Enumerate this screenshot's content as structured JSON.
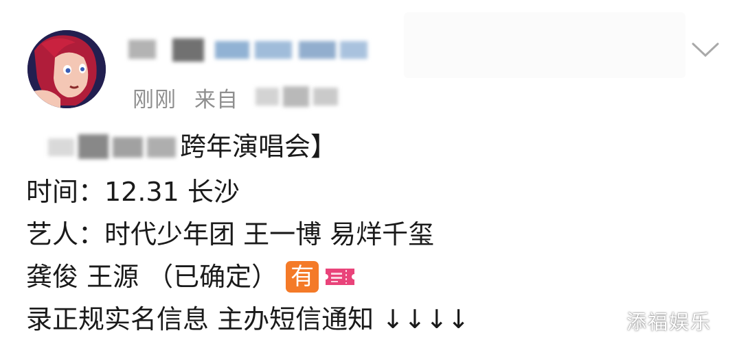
{
  "post": {
    "meta": {
      "time": "刚刚",
      "source_prefix": "来自"
    },
    "title_suffix": "跨年演唱会】",
    "lines": [
      "时间：12.31 长沙",
      "艺人：时代少年团 王一博 易烊千玺",
      "龚俊 王源 （已确定）",
      "录正规实名信息 主办短信通知 ↓↓↓↓"
    ],
    "emoji_you_label": "有",
    "emoji_colors": {
      "you": "#f47a28",
      "ticket": "#e9437a"
    },
    "icons": {
      "expand": "chevron-down-icon",
      "ticket": "ticket-icon",
      "avatar": "avatar-image"
    }
  },
  "watermark": "添福娱乐"
}
